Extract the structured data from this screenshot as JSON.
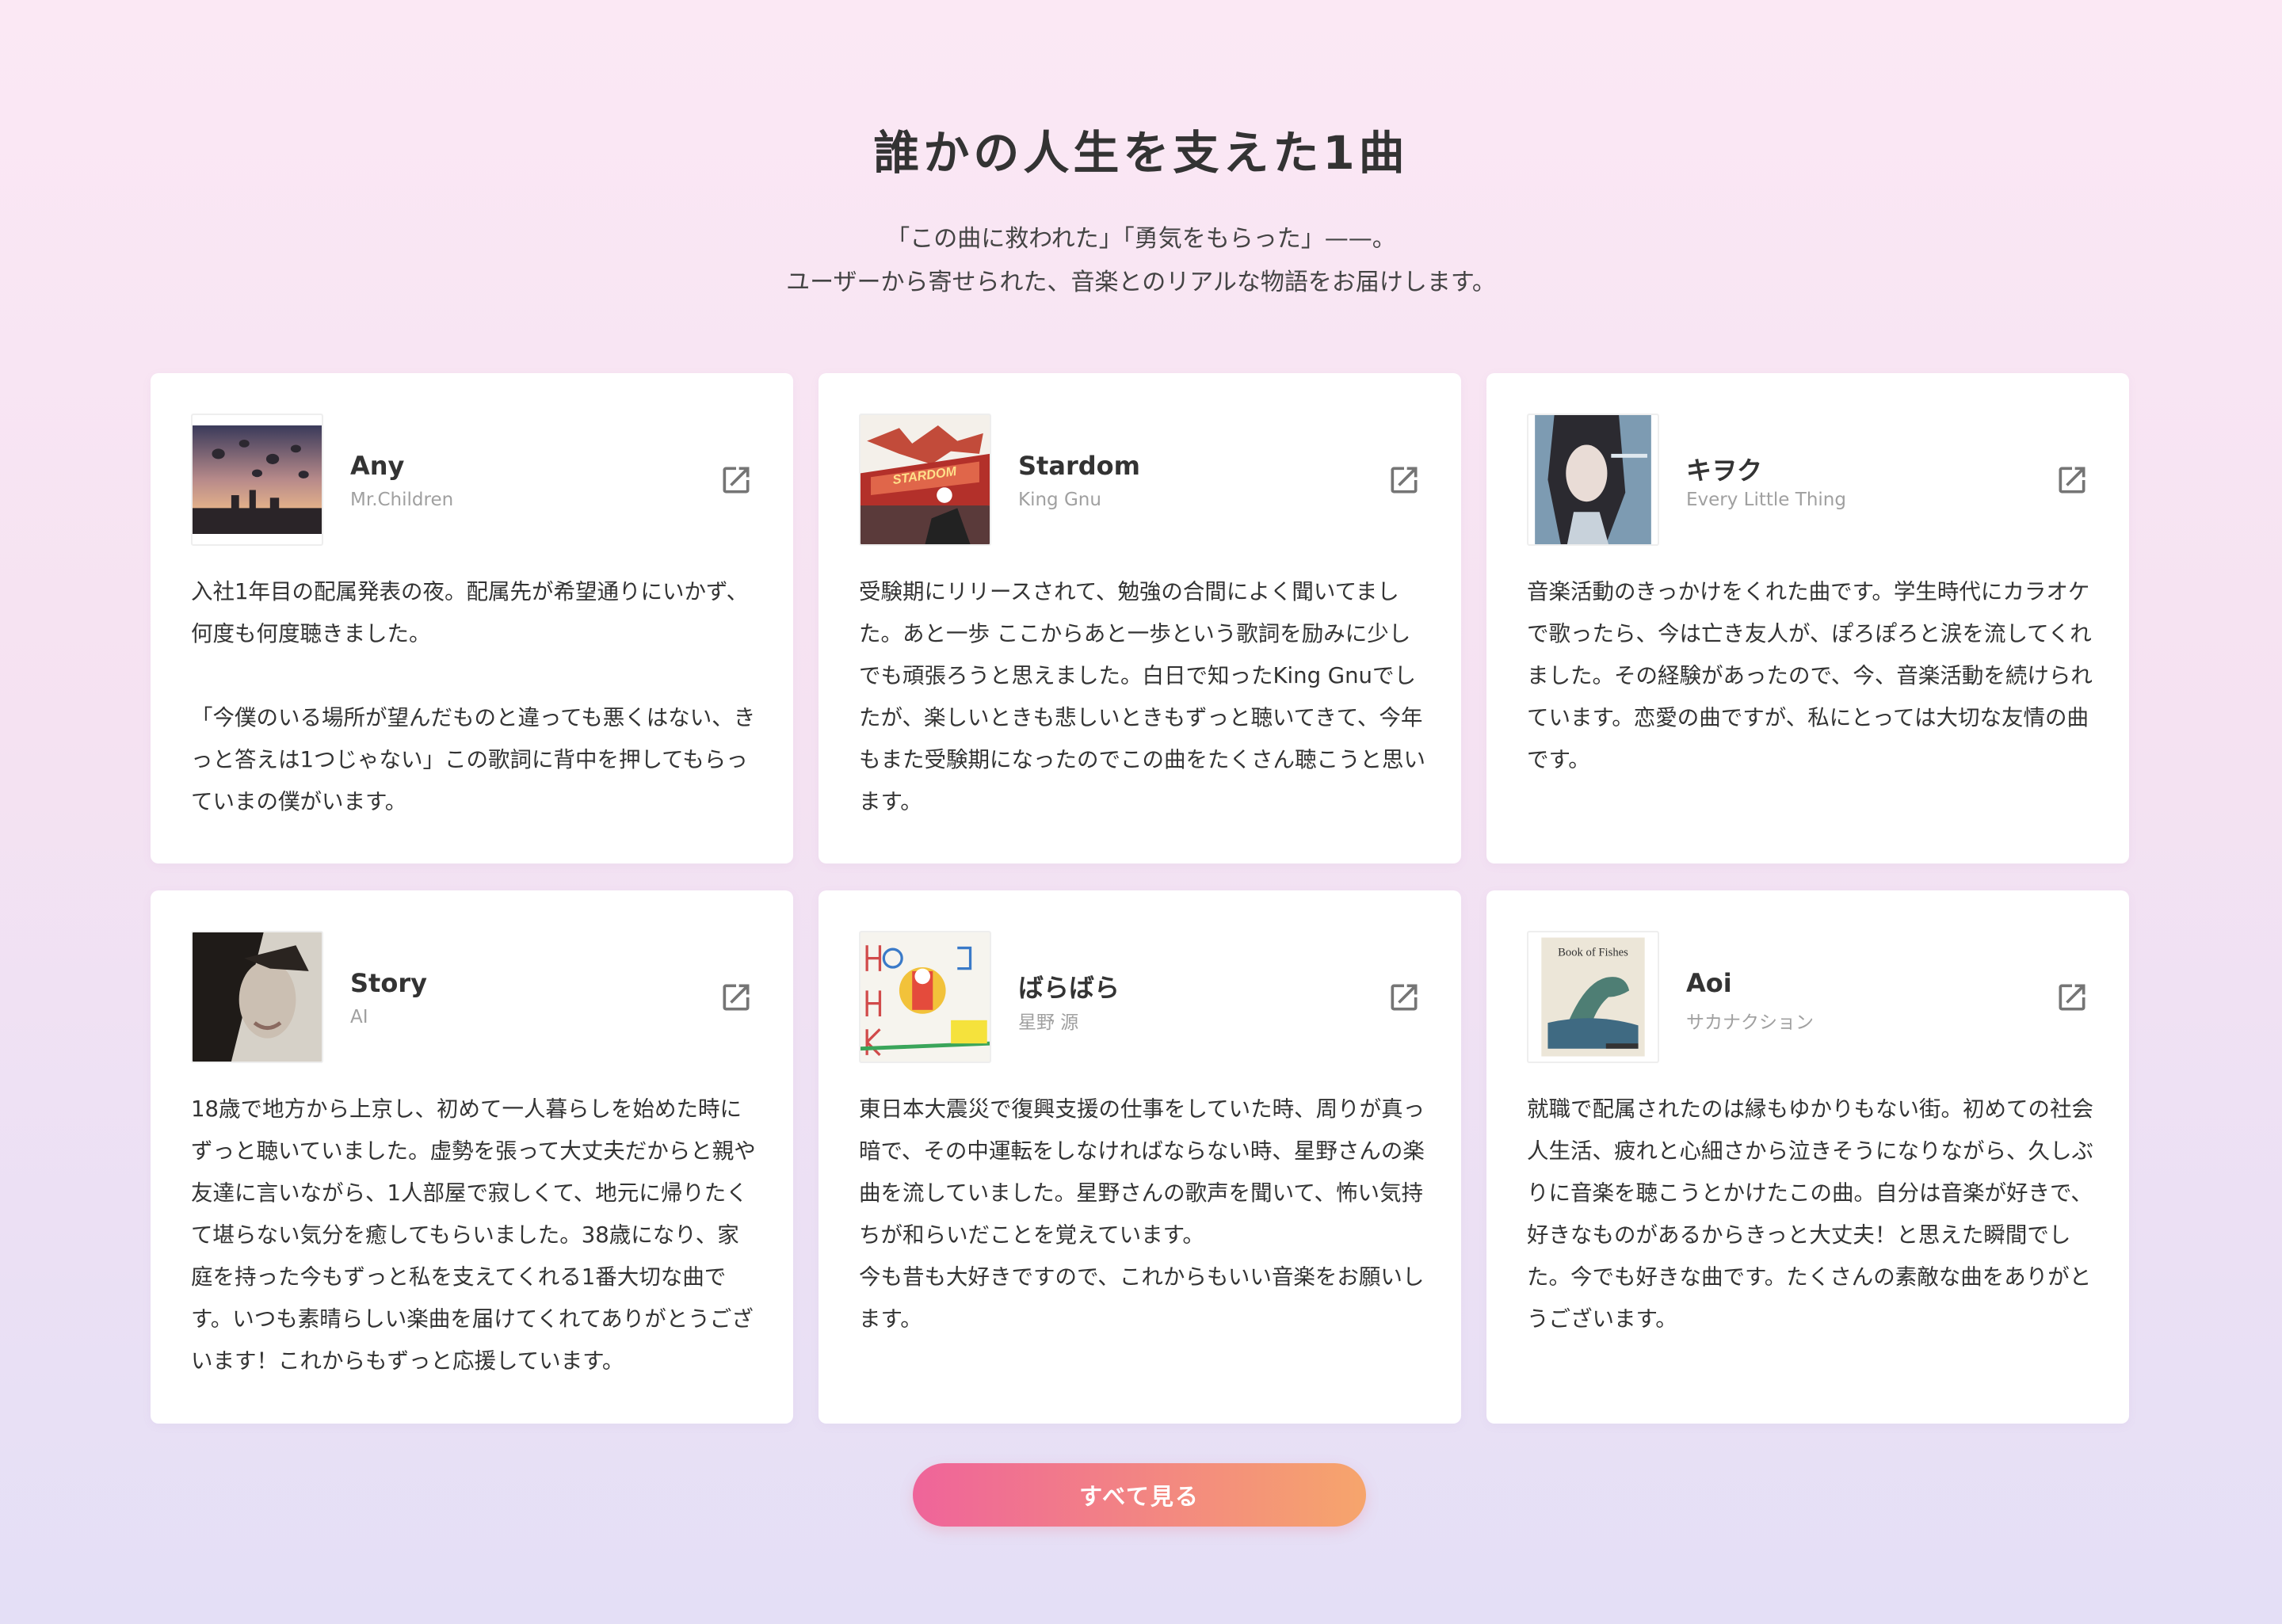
{
  "header": {
    "title": "誰かの人生を支えた1曲",
    "subtitle_line1": "「この曲に救われた」「勇気をもらった」——。",
    "subtitle_line2": "ユーザーから寄せられた、音楽とのリアルな物語をお届けします。"
  },
  "cards": [
    {
      "title": "Any",
      "artist": "Mr.Children",
      "cover_icon": "city-sunset-cover",
      "story": "入社1年目の配属発表の夜。配属先が希望通りにいかず、何度も何度聴きました。\n\n「今僕のいる場所が望んだものと違っても悪くはない、きっと答えは1つじゃない」この歌詞に背中を押してもらっていまの僕がいます。"
    },
    {
      "title": "Stardom",
      "artist": "King Gnu",
      "cover_icon": "stardom-ship-cover",
      "story": "受験期にリリースされて、勉強の合間によく聞いてました。あと一歩 ここからあと一歩という歌詞を励みに少しでも頑張ろうと思えました。白日で知ったKing Gnuでしたが、楽しいときも悲しいときもずっと聴いてきて、今年もまた受験期になったのでこの曲をたくさん聴こうと思います。"
    },
    {
      "title": "キヲク",
      "artist": "Every Little Thing",
      "cover_icon": "portrait-blue-cover",
      "story": "音楽活動のきっかけをくれた曲です。学生時代にカラオケで歌ったら、今は亡き友人が、ぽろぽろと涙を流してくれました。その経験があったので、今、音楽活動を続けられています。恋愛の曲ですが、私にとっては大切な友情の曲です。"
    },
    {
      "title": "Story",
      "artist": "AI",
      "cover_icon": "portrait-sepia-cover",
      "story": "18歳で地方から上京し、初めて一人暮らしを始めた時にずっと聴いていました。虚勢を張って大丈夫だからと親や友達に言いながら、1人部屋で寂しくて、地元に帰りたくて堪らない気分を癒してもらいました。38歳になり、家庭を持った今もずっと私を支えてくれる1番大切な曲です。いつも素晴らしい楽曲を届けてくれてありがとうございます！これからもずっと応援しています。"
    },
    {
      "title": "ばらばら",
      "artist": "星野 源",
      "cover_icon": "hand-drawn-cover",
      "story": "東日本大震災で復興支援の仕事をしていた時、周りが真っ暗で、その中運転をしなければならない時、星野さんの楽曲を流していました。星野さんの歌声を聞いて、怖い気持ちが和らいだことを覚えています。\n今も昔も大好きですので、これからもいい音楽をお願いします。"
    },
    {
      "title": "Aoi",
      "artist": "サカナクション",
      "cover_icon": "book-of-fishes-cover",
      "cover_text": "Book of Fishes",
      "story": "就職で配属されたのは縁もゆかりもない街。初めての社会人生活、疲れと心細さから泣きそうになりながら、久しぶりに音楽を聴こうとかけたこの曲。自分は音楽が好きで、好きなものがあるからきっと大丈夫！と思えた瞬間でした。今でも好きな曲です。たくさんの素敵な曲をありがとうございます。"
    }
  ],
  "see_all_label": "すべて見る",
  "icons": {
    "external_link": "external-link-icon"
  },
  "colors": {
    "button_start": "#ef649a",
    "button_end": "#f6a56c",
    "artist_gray": "#a0a0a0"
  }
}
